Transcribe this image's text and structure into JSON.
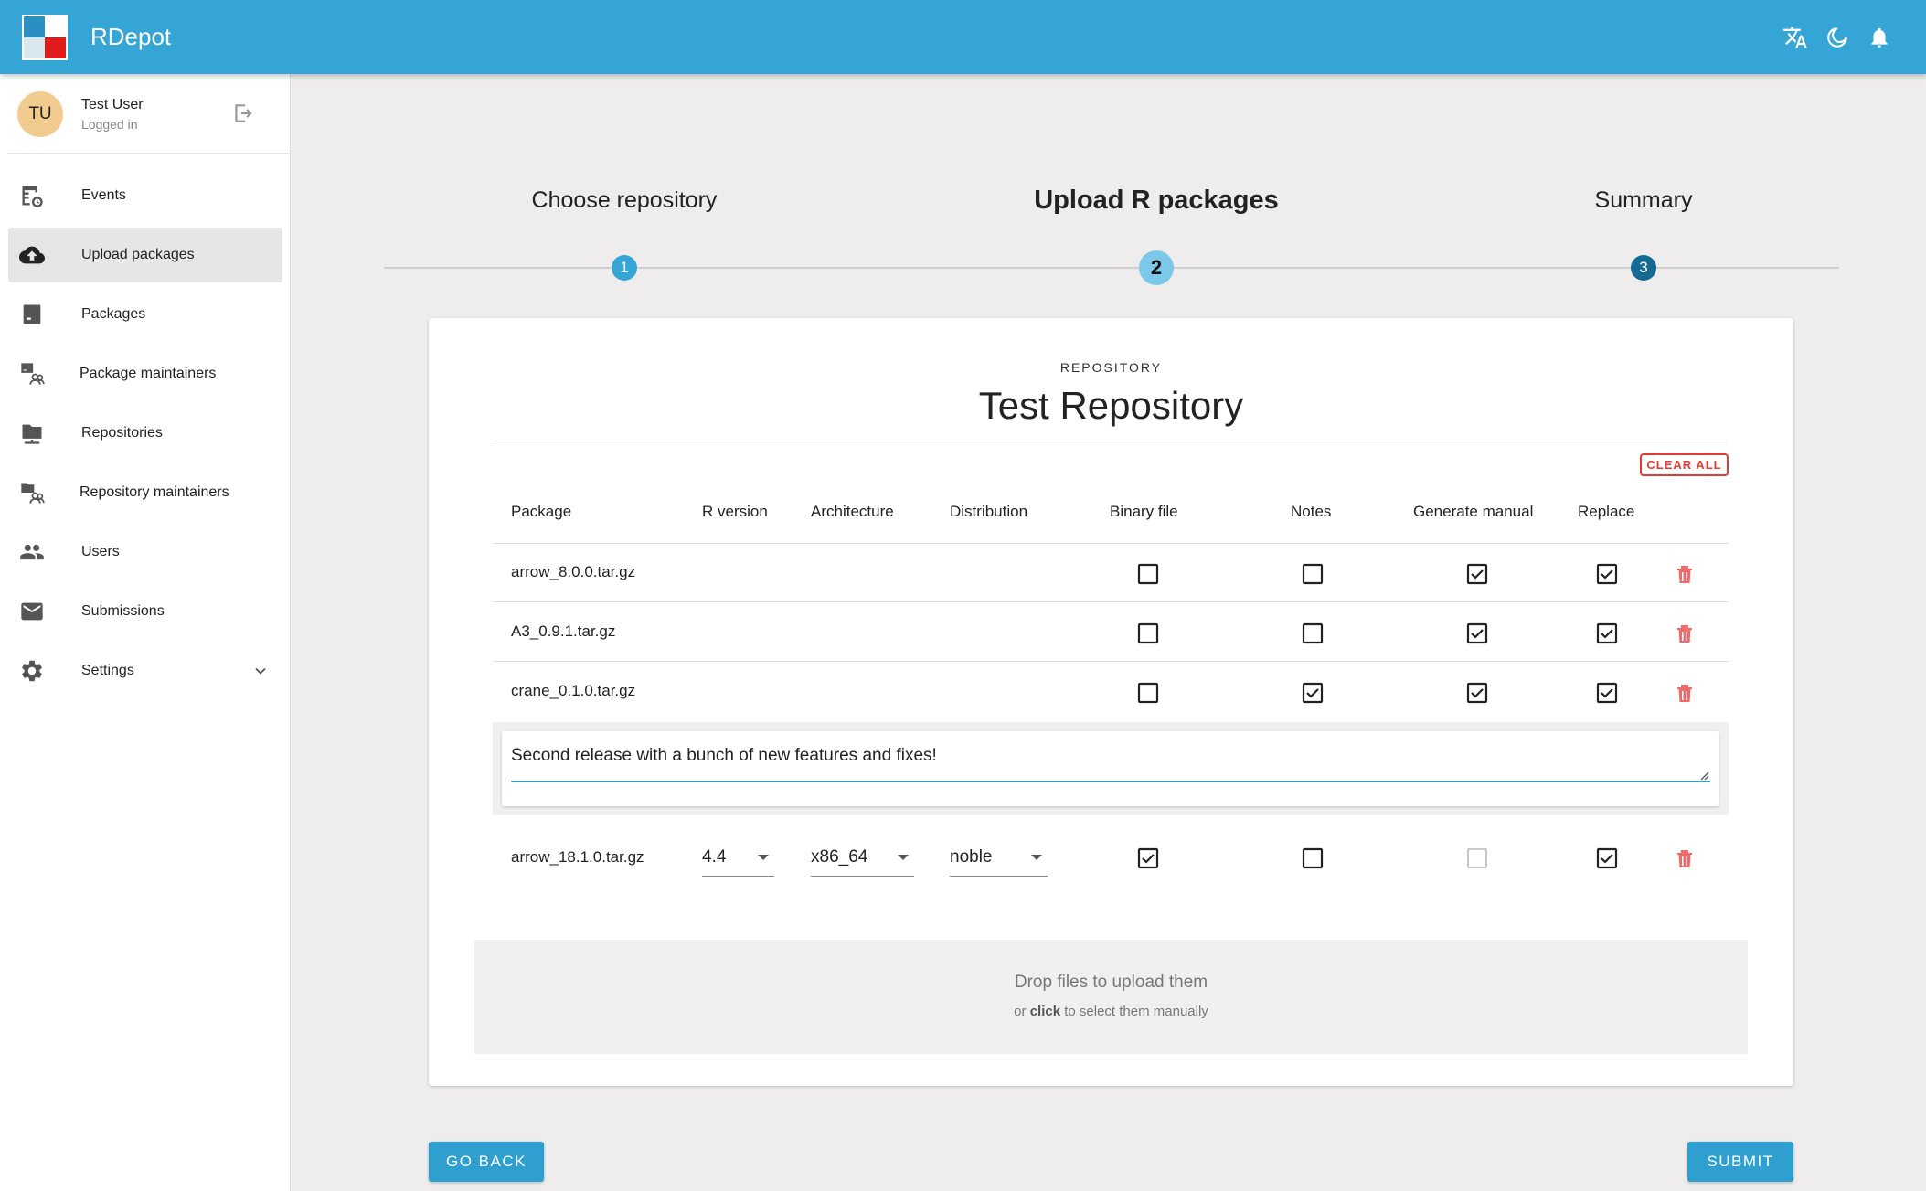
{
  "app": {
    "title": "RDepot"
  },
  "user": {
    "initials": "TU",
    "name": "Test User",
    "status": "Logged in"
  },
  "sidebar": {
    "items": [
      {
        "label": "Events",
        "icon": "events-icon"
      },
      {
        "label": "Upload packages",
        "icon": "cloud-upload-icon",
        "active": true
      },
      {
        "label": "Packages",
        "icon": "package-icon"
      },
      {
        "label": "Package maintainers",
        "icon": "package-maintainers-icon"
      },
      {
        "label": "Repositories",
        "icon": "folder-network-icon"
      },
      {
        "label": "Repository maintainers",
        "icon": "repository-maintainers-icon"
      },
      {
        "label": "Users",
        "icon": "users-icon"
      },
      {
        "label": "Submissions",
        "icon": "mail-icon"
      },
      {
        "label": "Settings",
        "icon": "gear-icon"
      }
    ]
  },
  "stepper": {
    "steps": [
      {
        "label": "Choose repository",
        "number": "1"
      },
      {
        "label": "Upload R packages",
        "number": "2",
        "active": true
      },
      {
        "label": "Summary",
        "number": "3"
      }
    ]
  },
  "card": {
    "overline": "REPOSITORY",
    "title": "Test Repository",
    "clear_all": "CLEAR ALL"
  },
  "table": {
    "headers": [
      "Package",
      "R version",
      "Architecture",
      "Distribution",
      "Binary file",
      "Notes",
      "Generate manual",
      "Replace"
    ],
    "rows": [
      {
        "package": "arrow_8.0.0.tar.gz",
        "binary": false,
        "notes": false,
        "manual": true,
        "replace": true
      },
      {
        "package": "A3_0.9.1.tar.gz",
        "binary": false,
        "notes": false,
        "manual": true,
        "replace": true
      },
      {
        "package": "crane_0.1.0.tar.gz",
        "binary": false,
        "notes": true,
        "manual": true,
        "replace": true
      },
      {
        "package": "arrow_18.1.0.tar.gz",
        "r_version": "4.4",
        "architecture": "x86_64",
        "distribution": "noble",
        "binary": true,
        "notes": false,
        "manual": false,
        "manual_disabled": true,
        "replace": true
      }
    ],
    "notes_text": "Second release with a bunch of new features and fixes!"
  },
  "dropzone": {
    "main": "Drop files to upload them",
    "sub_prefix": "or ",
    "sub_bold": "click",
    "sub_suffix": " to select them manually"
  },
  "buttons": {
    "back": "GO BACK",
    "submit": "SUBMIT"
  },
  "colors": {
    "primary": "#34a5d5",
    "danger": "#e53935",
    "step_dark": "#146a93",
    "step_light": "#7cc8e8"
  }
}
